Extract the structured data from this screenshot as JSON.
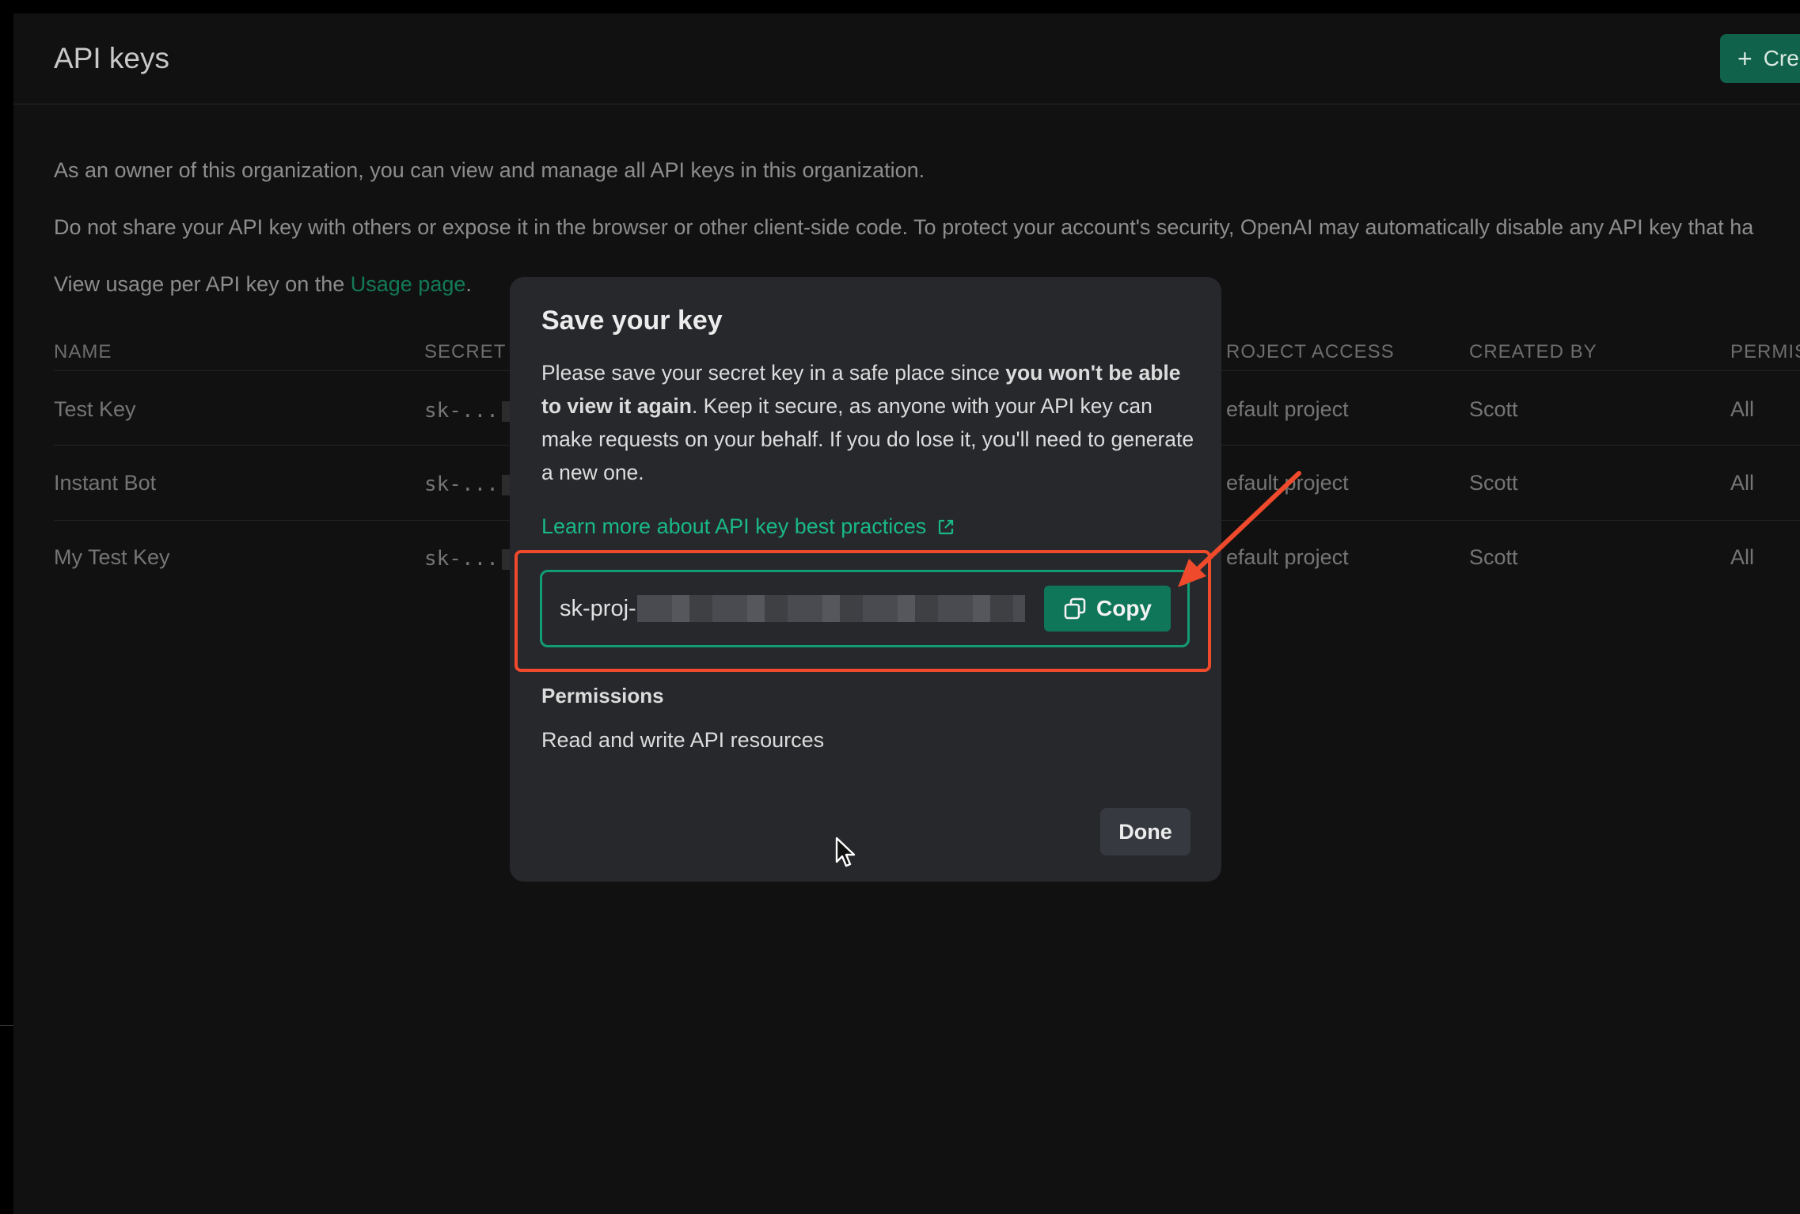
{
  "header": {
    "title": "API keys",
    "create_button": {
      "icon": "plus-icon",
      "label": "Cre"
    }
  },
  "intro": {
    "line1": "As an owner of this organization, you can view and manage all API keys in this organization.",
    "line2": "Do not share your API key with others or expose it in the browser or other client-side code. To protect your account's security, OpenAI may automatically disable any API key that ha",
    "line3_prefix": "View usage per API key on the ",
    "line3_link": "Usage page",
    "line3_suffix": "."
  },
  "table": {
    "columns": {
      "name": "NAME",
      "secret": "SECRET",
      "project_access": "ROJECT ACCESS",
      "created_by": "CREATED BY",
      "permissions": "PERMIS"
    },
    "rows": [
      {
        "name": "Test Key",
        "secret": "sk-...",
        "project": "efault project",
        "created_by": "Scott",
        "permissions": "All"
      },
      {
        "name": "Instant Bot",
        "secret": "sk-...",
        "project": "efault project",
        "created_by": "Scott",
        "permissions": "All"
      },
      {
        "name": "My Test Key",
        "secret": "sk-...",
        "project": "efault project",
        "created_by": "Scott",
        "permissions": "All"
      }
    ]
  },
  "modal": {
    "title": "Save your key",
    "text_before_bold": "Please save your secret key in a safe place since ",
    "text_bold": "you won't be able to view it again",
    "text_after_bold": ". Keep it secure, as anyone with your API key can make requests on your behalf. If you do lose it, you'll need to generate a new one.",
    "learn_link": "Learn more about API key best practices",
    "learn_link_icon": "external-link-icon",
    "key_prefix": "sk-proj-",
    "copy_button": {
      "icon": "copy-icon",
      "label": "Copy"
    },
    "permissions_title": "Permissions",
    "permissions_value": "Read and write API resources",
    "done_button": "Done"
  },
  "annotation": {
    "arrow_color": "#ee4a2b",
    "highlight_color": "#ee4a2b"
  },
  "colors": {
    "accent_green": "#10765a",
    "link_green": "#19b884",
    "background": "#111111",
    "modal_background": "#27282c"
  }
}
